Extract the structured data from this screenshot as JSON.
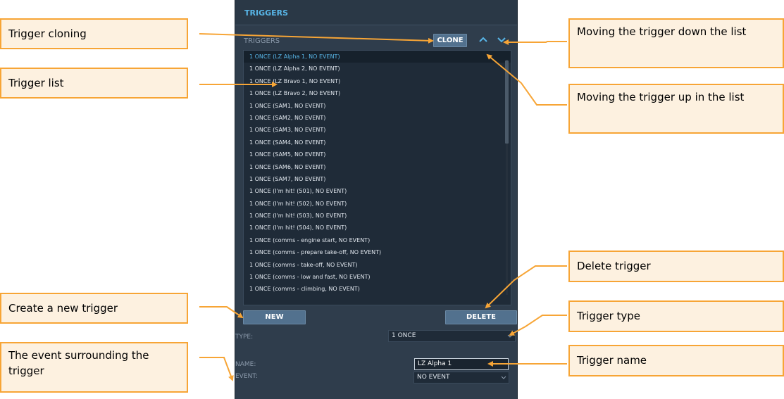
{
  "panel": {
    "title": "TRIGGERS",
    "section_label": "TRIGGERS",
    "clone_label": "CLONE",
    "up_icon": "chevron-up-icon",
    "down_icon": "chevron-down-icon",
    "list_items": [
      "1 ONCE (LZ Alpha 1, NO EVENT)",
      "1 ONCE (LZ Alpha 2, NO EVENT)",
      "1 ONCE (LZ Bravo 1, NO EVENT)",
      "1 ONCE (LZ Bravo 2, NO EVENT)",
      "1 ONCE (SAM1, NO EVENT)",
      "1 ONCE (SAM2, NO EVENT)",
      "1 ONCE (SAM3, NO EVENT)",
      "1 ONCE (SAM4, NO EVENT)",
      "1 ONCE (SAM5, NO EVENT)",
      "1 ONCE (SAM6, NO EVENT)",
      "1 ONCE (SAM7, NO EVENT)",
      "1 ONCE (I'm hit! (501), NO EVENT)",
      "1 ONCE (I'm hit! (502), NO EVENT)",
      "1 ONCE (I'm hit! (503), NO EVENT)",
      "1 ONCE (I'm hit! (504), NO EVENT)",
      "1 ONCE (comms - engine start, NO EVENT)",
      "1 ONCE (comms - prepare take-off, NO EVENT)",
      "1 ONCE (comms - take-off, NO EVENT)",
      "1 ONCE (comms - low and fast, NO EVENT)",
      "1 ONCE (comms - climbing, NO EVENT)"
    ],
    "selected_index": 0,
    "new_label": "NEW",
    "delete_label": "DELETE",
    "type_label": "TYPE:",
    "type_value": "1 ONCE",
    "name_label": "NAME:",
    "name_value": "LZ Alpha 1",
    "event_label": "EVENT:",
    "event_value": "NO EVENT"
  },
  "callouts": {
    "clone": "Trigger cloning",
    "list": "Trigger list",
    "move_down": "Moving the trigger down the list",
    "move_up": "Moving the trigger up in the list",
    "delete": "Delete trigger",
    "create": "Create a new trigger",
    "type": "Trigger type",
    "event": "The event surrounding the trigger",
    "name": "Trigger name"
  },
  "colors": {
    "panel_bg": "#2f3d4c",
    "accent": "#58b6e8",
    "callout_border": "#f7a536",
    "callout_fill": "#fdf1e0"
  }
}
